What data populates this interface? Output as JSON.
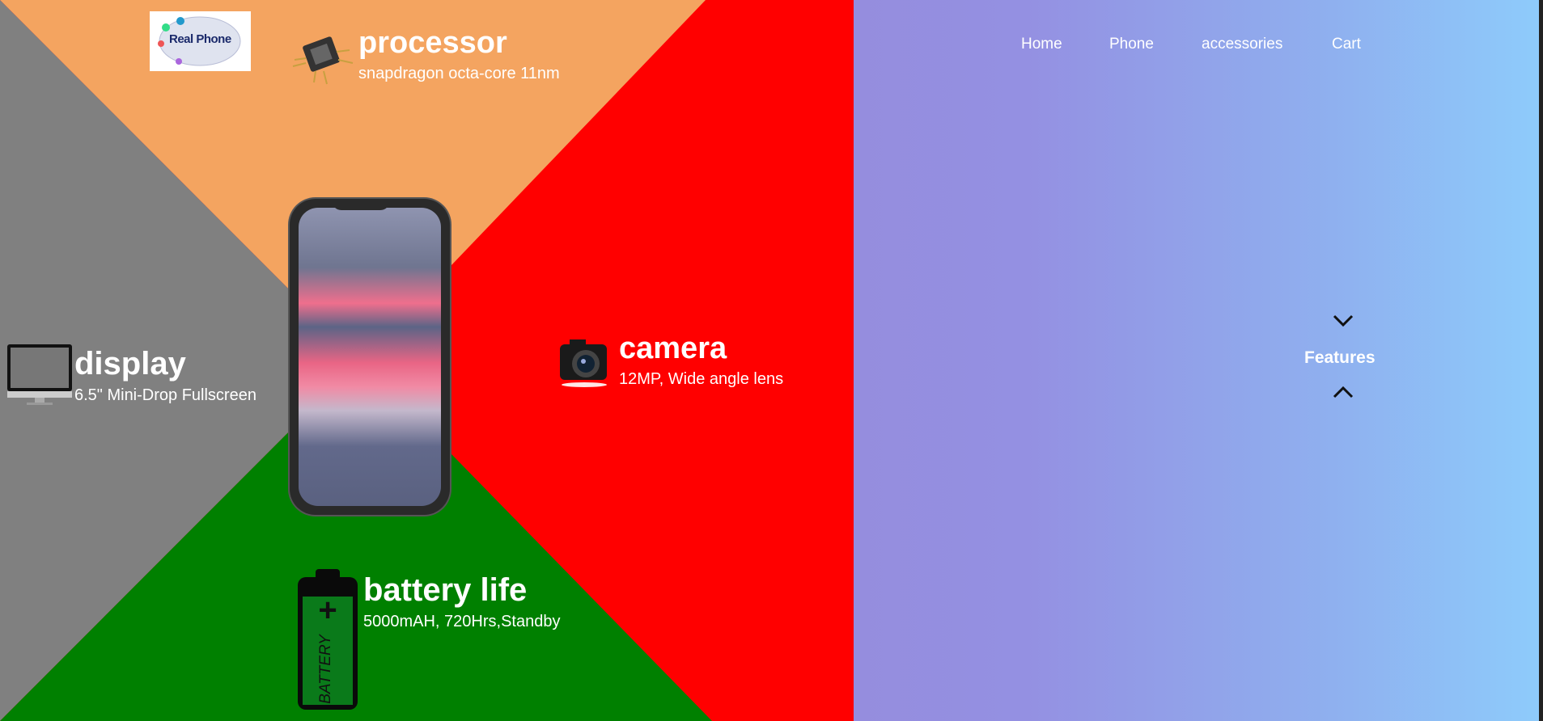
{
  "brand": {
    "logo_text": "Real Phone"
  },
  "nav": {
    "home": "Home",
    "phone": "Phone",
    "accessories": "accessories",
    "cart": "Cart"
  },
  "features": {
    "processor": {
      "title": "processor",
      "subtitle": "snapdragon octa-core 11nm",
      "icon": "chip-icon"
    },
    "camera": {
      "title": "camera",
      "subtitle": "12MP, Wide angle lens",
      "icon": "camera-icon"
    },
    "display": {
      "title": "display",
      "subtitle": "6.5\" Mini-Drop Fullscreen",
      "icon": "monitor-icon"
    },
    "battery": {
      "title": "battery life",
      "subtitle": "5000mAH, 720Hrs,Standby",
      "icon": "battery-icon",
      "label": "BATTERY"
    }
  },
  "side_panel": {
    "features_label": "Features"
  },
  "colors": {
    "orange": "#f4a460",
    "red": "#ff0000",
    "gray": "#808080",
    "green": "#008000",
    "gradient_start": "#958dde",
    "gradient_end": "#8ecbfb"
  }
}
